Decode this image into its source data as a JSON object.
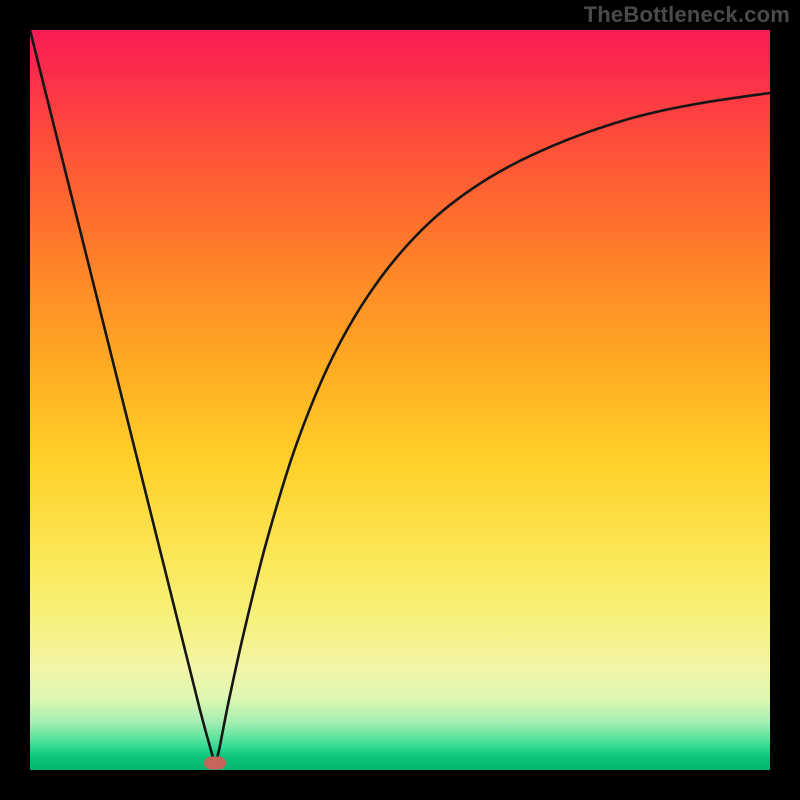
{
  "watermark": "TheBottleneck.com",
  "colors": {
    "frame_background": "#000000",
    "watermark_text": "#4a4a4a",
    "curve_stroke": "#161616",
    "marker_fill": "#c5655b",
    "gradient_top": "#f91b55",
    "gradient_bottom": "#05b571"
  },
  "chart_data": {
    "type": "line",
    "title": "",
    "xlabel": "",
    "ylabel": "",
    "xlim": [
      0,
      100
    ],
    "ylim": [
      0,
      100
    ],
    "grid": false,
    "legend": false,
    "annotations": [
      {
        "type": "marker",
        "x": 25,
        "y": 99,
        "label": "minimum"
      }
    ],
    "series": [
      {
        "name": "bottleneck-curve",
        "x": [
          0,
          5,
          10,
          14,
          18,
          21,
          23,
          24.5,
          25,
          25.5,
          26,
          27,
          29,
          32,
          36,
          41,
          47,
          54,
          62,
          71,
          81,
          90,
          100
        ],
        "values": [
          0,
          20,
          40,
          56,
          72,
          84,
          92,
          97.5,
          99,
          97.5,
          95,
          90,
          81,
          69,
          56,
          44,
          34,
          26,
          20,
          15.5,
          12,
          10,
          8.5
        ]
      }
    ]
  }
}
